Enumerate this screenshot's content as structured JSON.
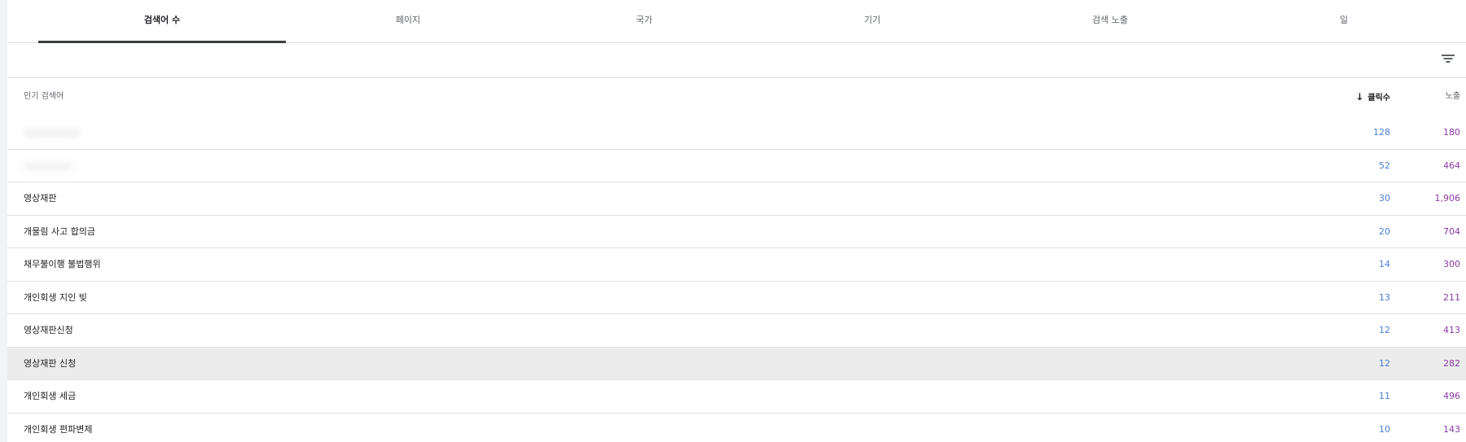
{
  "tabs": [
    {
      "label": "검색어 수",
      "active": true
    },
    {
      "label": "페이지",
      "active": false
    },
    {
      "label": "국가",
      "active": false
    },
    {
      "label": "기기",
      "active": false
    },
    {
      "label": "검색 노출",
      "active": false
    },
    {
      "label": "일",
      "active": false
    }
  ],
  "filter": {
    "icon": "filter-icon"
  },
  "table": {
    "headers": {
      "query": "인기 검색어",
      "clicks": "클릭수",
      "impressions": "노출",
      "sort_icon": "arrow-down-icon"
    },
    "rows": [
      {
        "query": "",
        "clicks": "128",
        "impressions": "180",
        "blurred": true
      },
      {
        "query": "",
        "clicks": "52",
        "impressions": "464",
        "blurred": true
      },
      {
        "query": "영상재판",
        "clicks": "30",
        "impressions": "1,906"
      },
      {
        "query": "개물림 사고 합의금",
        "clicks": "20",
        "impressions": "704"
      },
      {
        "query": "채무불이행 불법행위",
        "clicks": "14",
        "impressions": "300"
      },
      {
        "query": "개인회생 지인 빚",
        "clicks": "13",
        "impressions": "211"
      },
      {
        "query": "영상재판신청",
        "clicks": "12",
        "impressions": "413"
      },
      {
        "query": "영상재판 신청",
        "clicks": "12",
        "impressions": "282",
        "highlight": true
      },
      {
        "query": "개인회생 세금",
        "clicks": "11",
        "impressions": "496"
      },
      {
        "query": "개인회생 편파변제",
        "clicks": "10",
        "impressions": "143"
      }
    ]
  },
  "colors": {
    "clicks": "#4a7fd4",
    "impressions": "#8c3aa6",
    "active_tab_underline": "#3c4043"
  }
}
